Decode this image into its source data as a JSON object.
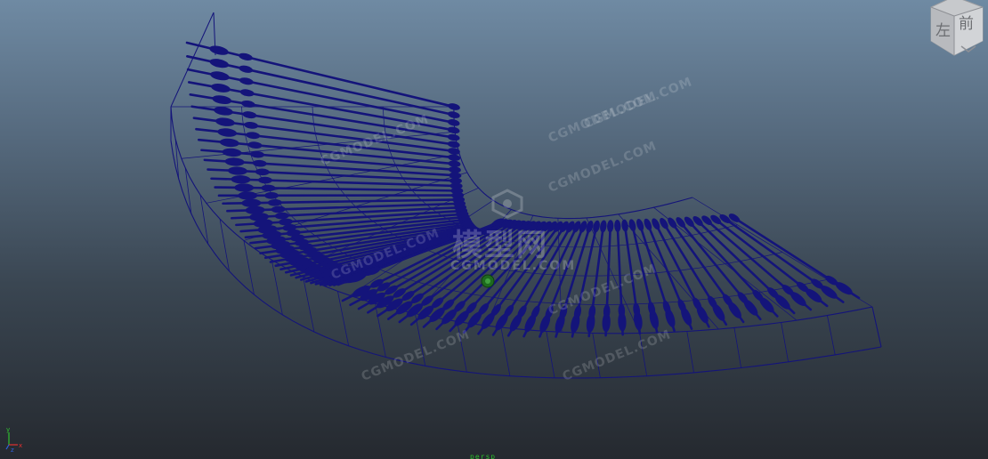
{
  "viewport": {
    "camera_label": "persp",
    "colors": {
      "wireframe": "#14147a",
      "pivot": "#1e6a1e",
      "camera_label": "#2cbd2c"
    }
  },
  "view_cube": {
    "face_left": "左",
    "face_front": "前"
  },
  "watermark": {
    "logo": "模型网",
    "subtitle": "CGMODEL.COM",
    "tile": "CGMODEL.COM"
  },
  "model": {
    "inner_rail_count": 40,
    "outer_rail_count": 36
  },
  "axis_gizmo": {
    "x": "x",
    "y": "y",
    "z": "z",
    "colors": {
      "x": "#e03030",
      "y": "#30c030",
      "z": "#3060e0"
    }
  }
}
